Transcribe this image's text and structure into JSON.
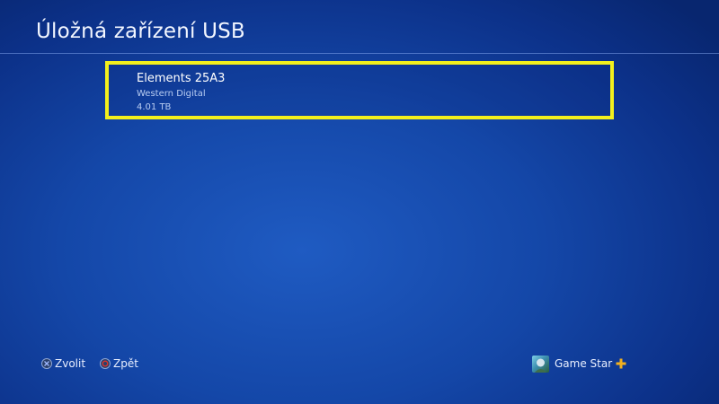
{
  "header": {
    "title": "Úložná zařízení USB"
  },
  "devices": [
    {
      "name": "Elements 25A3",
      "manufacturer": "Western Digital",
      "capacity": "4.01 TB",
      "selected": true
    }
  ],
  "footer": {
    "select_label": "Zvolit",
    "select_icon": "cross-button-icon",
    "back_label": "Zpět",
    "back_icon": "circle-button-icon",
    "user_name": "Game Star",
    "plus_icon": "playstation-plus-icon"
  },
  "colors": {
    "background": "#1447a8",
    "selection_border": "#f3f01c",
    "plus_gold": "#f2b01e",
    "circle_red": "#d9342b"
  }
}
